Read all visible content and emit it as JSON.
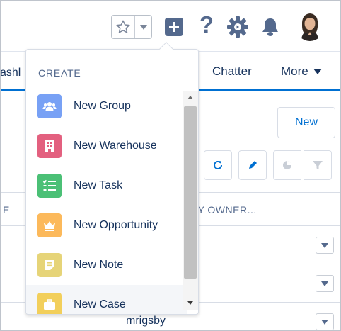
{
  "header": {
    "favorites_icon": "star-icon",
    "favorites_menu_icon": "caret-down-icon",
    "global_create_icon": "plus-icon",
    "help_icon": "question-icon",
    "help_glyph": "?",
    "setup_icon": "gear-icon",
    "notifications_icon": "bell-icon",
    "avatar_icon": "user-avatar"
  },
  "nav": {
    "partial_tab": "ashl",
    "chatter": "Chatter",
    "more": "More"
  },
  "panel": {
    "new_button": "New",
    "toolbar_icons": [
      "refresh-icon",
      "pencil-icon",
      "pie-chart-icon",
      "filter-icon"
    ],
    "columns": [
      "E",
      "ITY OWNER..."
    ],
    "rows": [
      {
        "owner": ""
      },
      {
        "owner": ""
      },
      {
        "owner": "mrigsby"
      }
    ]
  },
  "dropdown": {
    "title": "CREATE",
    "items": [
      {
        "label": "New Group",
        "icon": "group-icon",
        "color": "#78a1f5"
      },
      {
        "label": "New Warehouse",
        "icon": "building-icon",
        "color": "#e3607f"
      },
      {
        "label": "New Task",
        "icon": "task-list-icon",
        "color": "#4bc076"
      },
      {
        "label": "New Opportunity",
        "icon": "crown-icon",
        "color": "#fcb95b"
      },
      {
        "label": "New Note",
        "icon": "note-icon",
        "color": "#e6d478"
      },
      {
        "label": "New Case",
        "icon": "briefcase-icon",
        "color": "#f2cf5b"
      }
    ]
  },
  "colors": {
    "accent": "#0070d2",
    "icon_gray": "#54698d",
    "text": "#16325c"
  }
}
